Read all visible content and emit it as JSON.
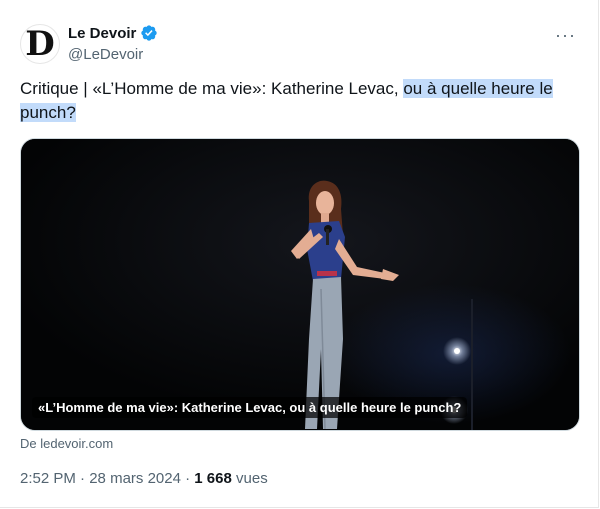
{
  "author": {
    "display_name": "Le Devoir",
    "handle": "@LeDevoir",
    "avatar_letter": "D",
    "verified_icon": "verified-badge-icon",
    "verified_color": "#1d9bf0"
  },
  "menu": {
    "more_label": "···"
  },
  "tweet": {
    "text_plain": "Critique | «L’Homme de ma vie»: Katherine Levac, ",
    "text_highlighted": "ou à quelle heure le punch?",
    "highlight_color": "#c2dbfa"
  },
  "link_card": {
    "caption": "«L’Homme de ma vie»: Katherine Levac, ou à quelle heure le punch?",
    "source": "De ledevoir.com"
  },
  "footer": {
    "time": "2:52 PM",
    "separator1": " · ",
    "date": "28 mars 2024",
    "separator2": " · ",
    "views_count": "1 668",
    "views_label": " vues"
  }
}
